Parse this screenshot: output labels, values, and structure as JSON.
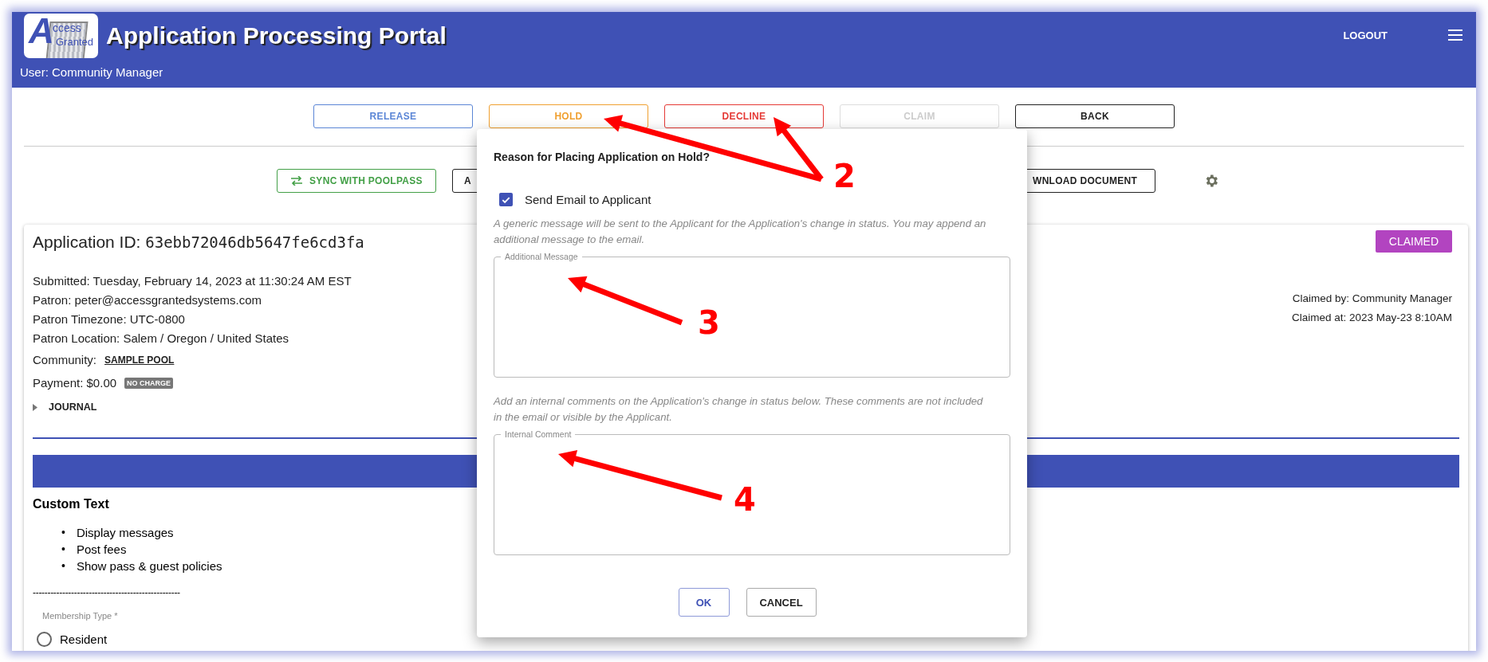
{
  "header": {
    "logo": {
      "initial": "A",
      "line1": "ccess",
      "line2": "Granted"
    },
    "title": "Application Processing Portal",
    "user": "User: Community Manager",
    "logout": "LOGOUT"
  },
  "actions": [
    {
      "label": "RELEASE",
      "kind": "release",
      "disabled": false
    },
    {
      "label": "HOLD",
      "kind": "hold",
      "disabled": false
    },
    {
      "label": "DECLINE",
      "kind": "decline",
      "disabled": false
    },
    {
      "label": "CLAIM",
      "kind": "claim",
      "disabled": true
    },
    {
      "label": "BACK",
      "kind": "back",
      "disabled": false
    }
  ],
  "toolbar": {
    "sync": "SYNC WITH POOLPASS",
    "partial_left": "A",
    "download": "WNLOAD DOCUMENT"
  },
  "application": {
    "id_label": "Application ID:",
    "id": "63ebb72046db5647fe6cd3fa",
    "status": "CLAIMED",
    "details": [
      "Submitted: Tuesday, February 14, 2023 at 11:30:24 AM EST",
      "Patron: peter@accessgrantedsystems.com",
      "Patron Timezone: UTC-0800",
      "Patron Location: Salem / Oregon / United States"
    ],
    "community_label": "Community:",
    "community": "SAMPLE POOL",
    "payment": "Payment: $0.00",
    "payment_badge": "NO CHARGE",
    "journal": "JOURNAL",
    "journal_expanded": false,
    "claimed_by": "Claimed by: Community Manager",
    "claimed_at": "Claimed at: 2023 May-23 8:10AM"
  },
  "form": {
    "heading": "Custom Text",
    "bullet_marker": "•",
    "bullets": [
      "Display messages",
      "Post fees",
      "Show pass & guest policies"
    ],
    "separator": "--------------------------------------------------",
    "field_label": "Membership Type *",
    "options": [
      {
        "label": "Resident",
        "selected": false
      }
    ]
  },
  "dialog": {
    "title": "Reason for Placing Application on Hold?",
    "send_email": {
      "label": "Send Email to Applicant",
      "checked": true
    },
    "email_help": "A generic message will be sent to the Applicant for the Application's change in status. You may append an additional message to the email.",
    "message_label": "Additional Message",
    "comment_help": "Add an internal comments on the Application's change in status below. These comments are not included in the email or visible by the Applicant.",
    "comment_label": "Internal Comment",
    "ok": "OK",
    "cancel": "CANCEL"
  },
  "annotations": [
    {
      "label": "2"
    },
    {
      "label": "3"
    },
    {
      "label": "4"
    }
  ]
}
